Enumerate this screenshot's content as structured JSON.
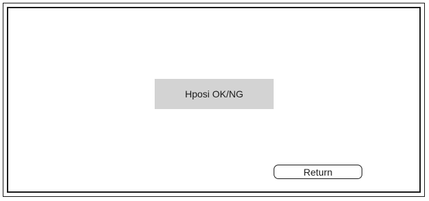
{
  "screen": {
    "status_text": "Hposi OK/NG",
    "return_label": "Return"
  },
  "colors": {
    "status_box_bg": "#d3d3d3",
    "frame": "#1a1a1a",
    "background": "#ffffff"
  }
}
